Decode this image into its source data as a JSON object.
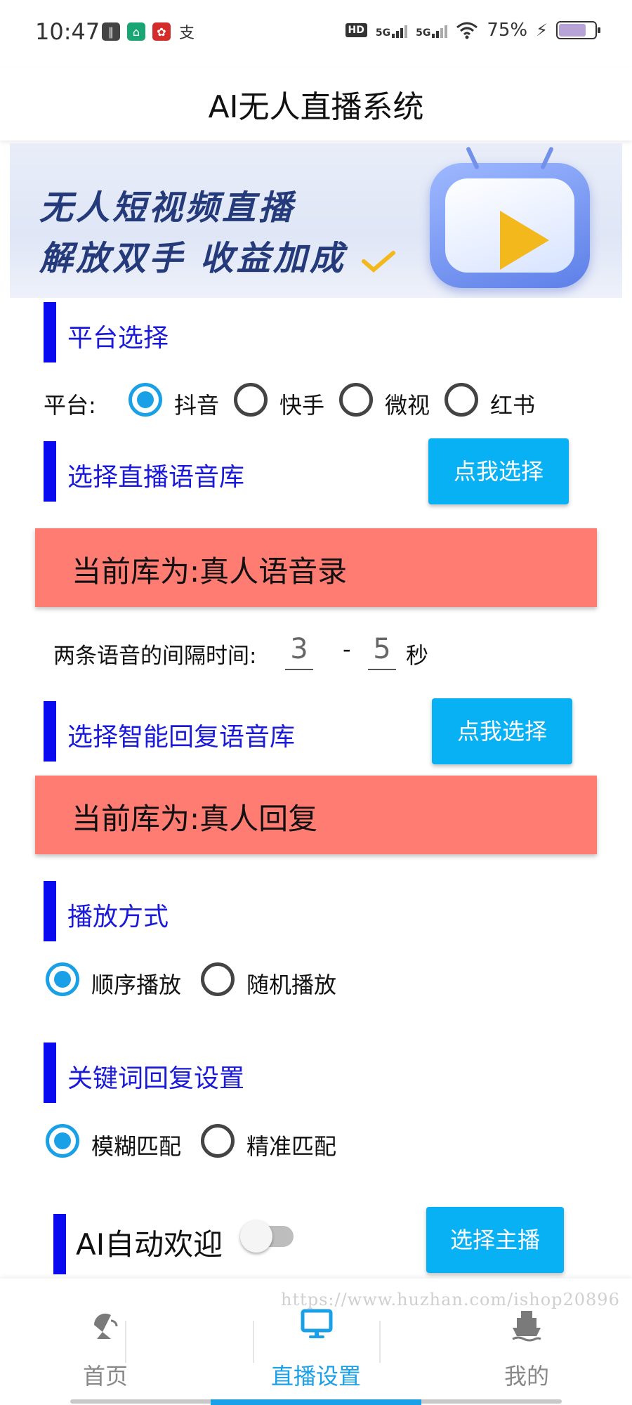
{
  "status_bar": {
    "time": "10:47",
    "hd_label": "HD",
    "network_1": "5G",
    "network_2": "5G",
    "battery": "75%"
  },
  "title_bar": {
    "title": "AI无人直播系统"
  },
  "banner": {
    "line1": "无人短视频直播",
    "line2": "解放双手 收益加成"
  },
  "platform_section": {
    "title": "平台选择",
    "label": "平台:",
    "options": [
      "抖音",
      "快手",
      "微视",
      "红书"
    ],
    "selected": "抖音"
  },
  "voice_library": {
    "title": "选择直播语音库",
    "button": "点我选择",
    "current": "当前库为:真人语音录"
  },
  "interval": {
    "label": "两条语音的间隔时间:",
    "min": "3",
    "separator": "-",
    "max": "5",
    "unit": "秒"
  },
  "reply_library": {
    "title": "选择智能回复语音库",
    "button": "点我选择",
    "current": "当前库为:真人回复"
  },
  "play_mode": {
    "title": "播放方式",
    "options": [
      "顺序播放",
      "随机播放"
    ],
    "selected": "顺序播放"
  },
  "keyword_reply": {
    "title": "关键词回复设置",
    "options": [
      "模糊匹配",
      "精准匹配"
    ],
    "selected": "模糊匹配"
  },
  "ai_welcome": {
    "title": "AI自动欢迎",
    "toggle_on": false,
    "button": "选择主播"
  },
  "watermark": "https://www.huzhan.com/ishop20896",
  "bottom_nav": {
    "items": [
      {
        "label": "首页",
        "icon": "satellite-dish-icon"
      },
      {
        "label": "直播设置",
        "icon": "monitor-icon"
      },
      {
        "label": "我的",
        "icon": "ship-icon"
      }
    ],
    "active_index": 1
  },
  "colors": {
    "accent": "#1aa0e6",
    "section_bar": "#0a0af0",
    "section_title": "#1a1ad8",
    "library_box": "#fe7c72",
    "button": "#08b0f4"
  }
}
